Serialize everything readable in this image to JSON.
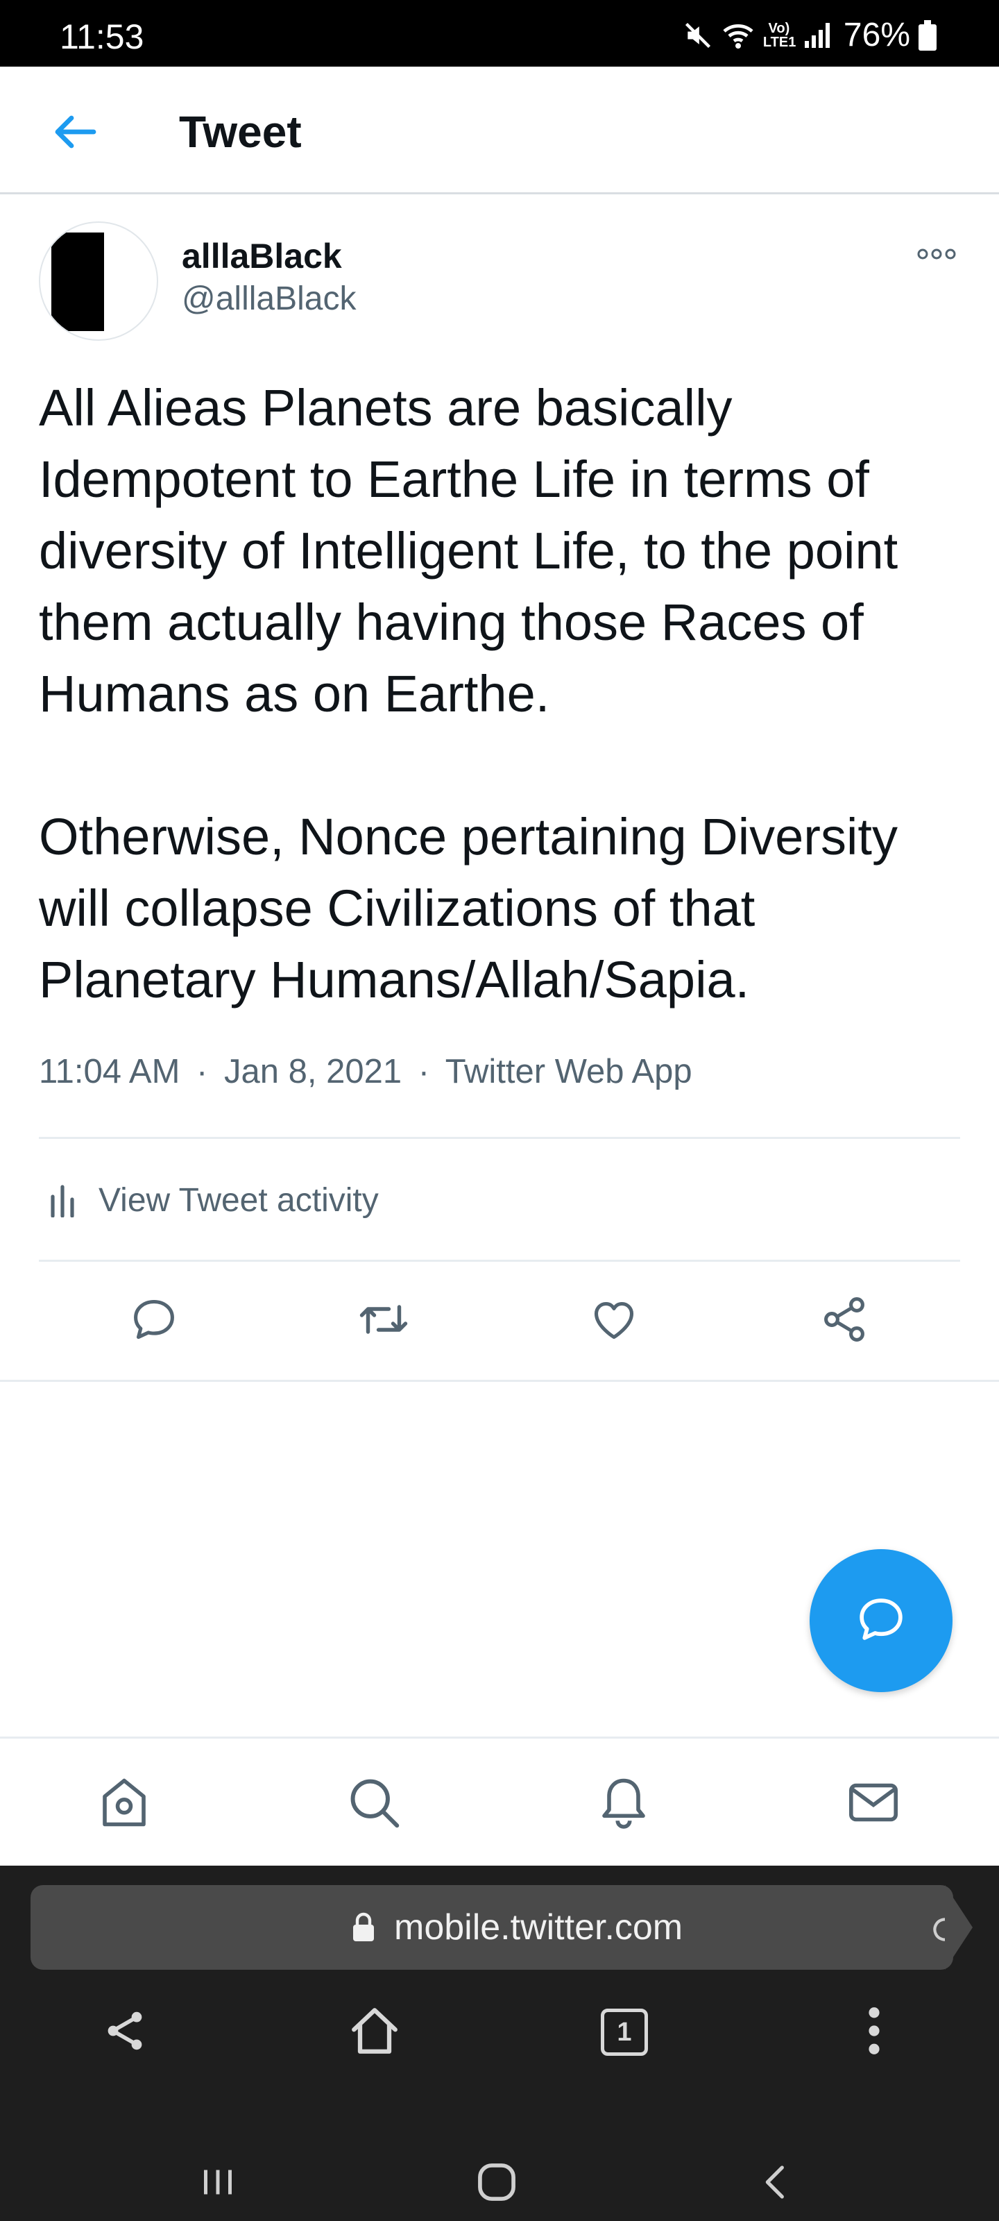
{
  "status_bar": {
    "time": "11:53",
    "network_label": "Vo) LTE1",
    "battery": "76%",
    "icons": [
      "mute-icon",
      "wifi-icon",
      "signal-icon",
      "battery-icon"
    ]
  },
  "header": {
    "title": "Tweet",
    "back_icon": "arrow-left-icon"
  },
  "tweet": {
    "display_name": "alllaBlack",
    "handle": "@alllaBlack",
    "text": "All Alieas Planets are basically Idempotent to Earthe Life in terms of diversity of Intelligent Life, to the point them actually having those Races of Humans as on Earthe.\n\nOtherwise, Nonce pertaining Diversity will collapse Civilizations of that Planetary Humans/Allah/Sapia.",
    "time": "11:04 AM",
    "date": "Jan 8, 2021",
    "source": "Twitter Web App",
    "separator": "·",
    "activity_label": "View Tweet activity"
  },
  "actions": [
    "reply-icon",
    "retweet-icon",
    "like-icon",
    "share-icon"
  ],
  "bottom_nav": [
    "home-icon",
    "search-icon",
    "notifications-icon",
    "messages-icon"
  ],
  "browser": {
    "url": "mobile.twitter.com",
    "tab_count": "1"
  },
  "colors": {
    "accent": "#1d9bf0",
    "text_primary": "#0f1419",
    "text_secondary": "#536471",
    "browser_bg": "#1e1e1e",
    "url_bar_bg": "#4a4a4a"
  }
}
